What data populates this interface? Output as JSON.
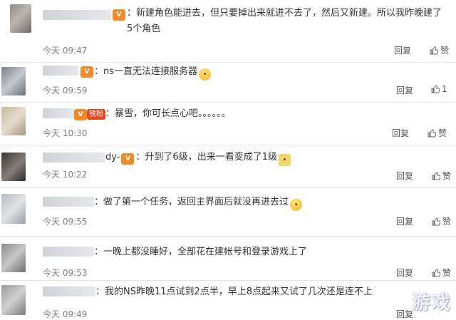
{
  "comments": [
    {
      "text": "：新建角色能进去，但只要掉出来就进不去了，然后又新建。所以我昨晚建了5个角色",
      "time": "今天 09:47",
      "reply": "回复",
      "like": "赞"
    },
    {
      "text": "：ns一直无法连接服务器",
      "time": "今天 09:59",
      "reply": "回复",
      "like": "1"
    },
    {
      "badge": "铁粉",
      "text": "：暴雪，你可长点心吧。。。。。。",
      "time": "今天 10:30",
      "reply": "回复",
      "like": "赞"
    },
    {
      "name": "dy-",
      "text": "：升到了6级，出来一看变成了1级",
      "time": "今天 10:22",
      "reply": "回复",
      "like": "赞"
    },
    {
      "text": "：做了第一个任务，返回主界面后就没再进去过",
      "time": "今天 09:55",
      "reply": "回复",
      "like": "赞"
    },
    {
      "text": "：一晚上都没睡好，全部花在建帐号和登录游戏上了",
      "time": "今天 09:53",
      "reply": "回复",
      "like": "赞"
    },
    {
      "text": "：我的NS昨晚11点试到2点半，早上8点起来又试了几次还是连不上",
      "time": "今天 09:49",
      "reply": "回复"
    }
  ],
  "watermark": "游戏",
  "colors": {
    "badge_vip": "#f08a2a",
    "badge_fan": "#e8471f",
    "muted": "#808080"
  }
}
